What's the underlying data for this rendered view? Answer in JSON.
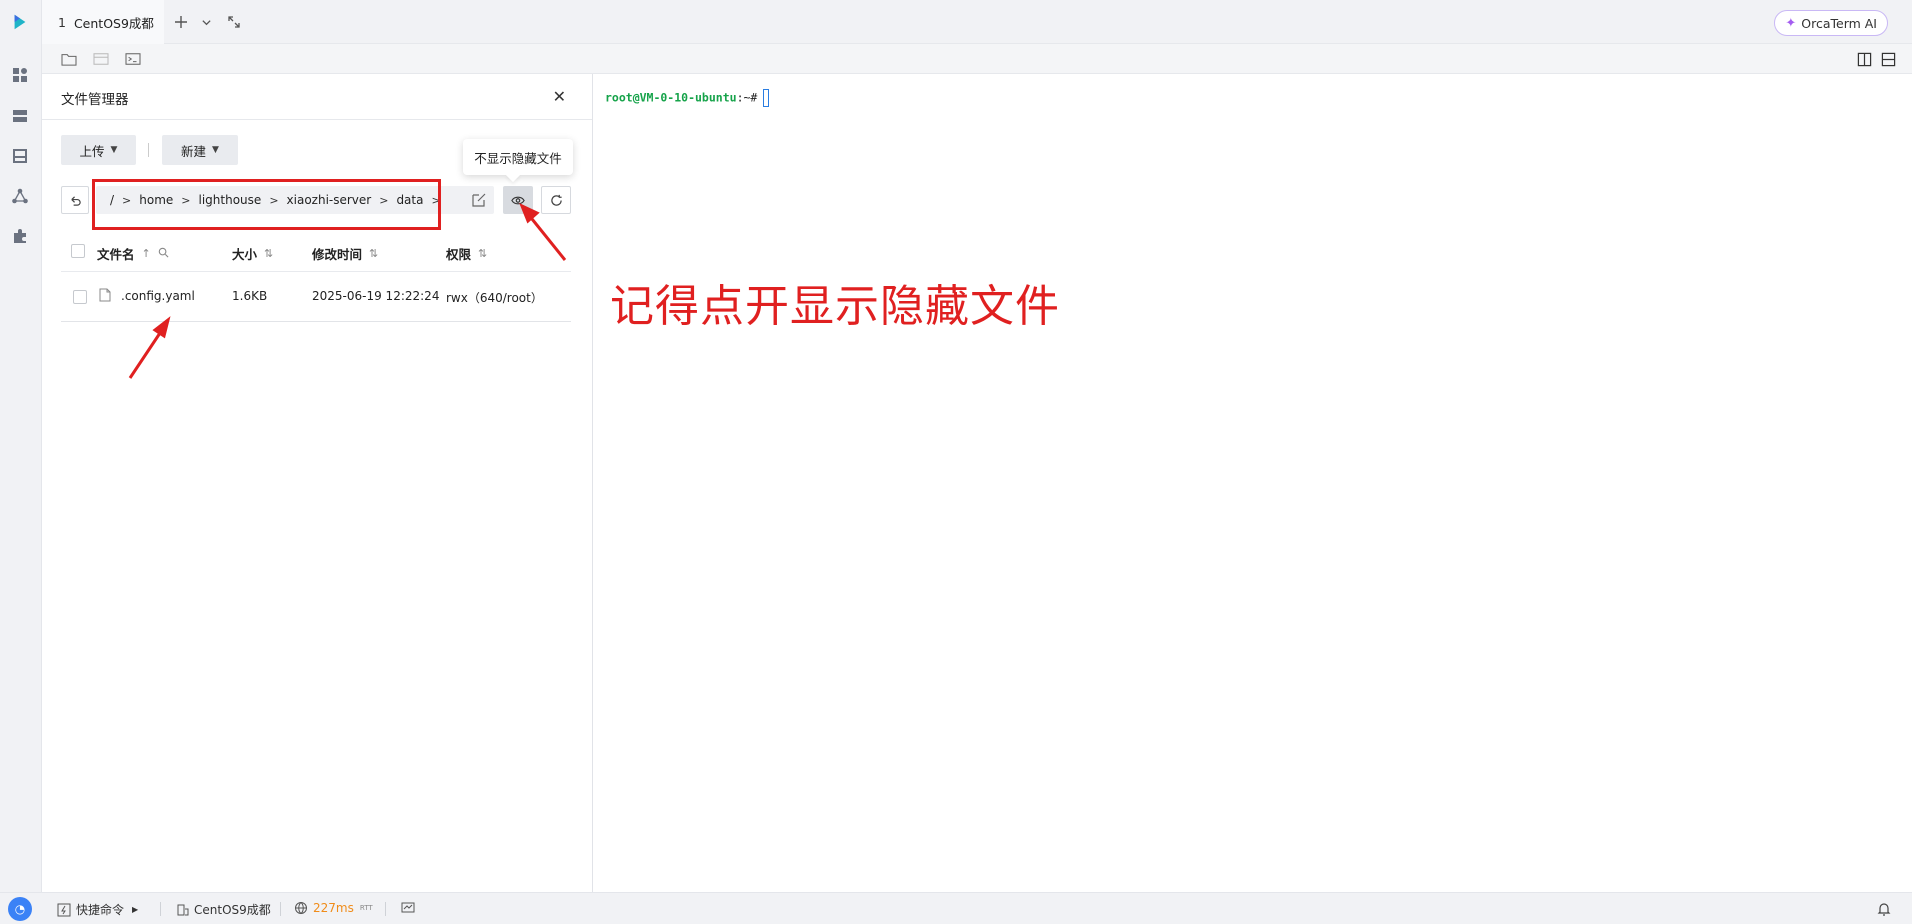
{
  "tabs": [
    {
      "num": "1",
      "label": "CentOS9成都"
    }
  ],
  "ai_button": {
    "label": "OrcaTerm AI"
  },
  "rail_icons": [
    "logo-icon",
    "dashboard-icon",
    "server-icon",
    "storage-icon",
    "network-icon",
    "plugin-icon"
  ],
  "file_manager": {
    "title": "文件管理器",
    "upload_label": "上传",
    "new_label": "新建",
    "tooltip": "不显示隐藏文件",
    "path": [
      "/",
      "home",
      "lighthouse",
      "xiaozhi-server",
      "data"
    ],
    "columns": {
      "name": "文件名",
      "size": "大小",
      "mtime": "修改时间",
      "perm": "权限"
    },
    "rows": [
      {
        "name": ".config.yaml",
        "size": "1.6KB",
        "mtime": "2025-06-19 12:22:24",
        "perm": "rwx（640/root）"
      }
    ]
  },
  "terminal": {
    "prompt_user": "root@VM-0-10-ubuntu",
    "prompt_rest": ":~#"
  },
  "annotation": {
    "text": "记得点开显示隐藏文件",
    "color": "#e02020"
  },
  "statusbar": {
    "quick_cmd": "快捷命令",
    "host": "CentOS9成都",
    "latency": "227ms",
    "rtt": "RTT"
  }
}
